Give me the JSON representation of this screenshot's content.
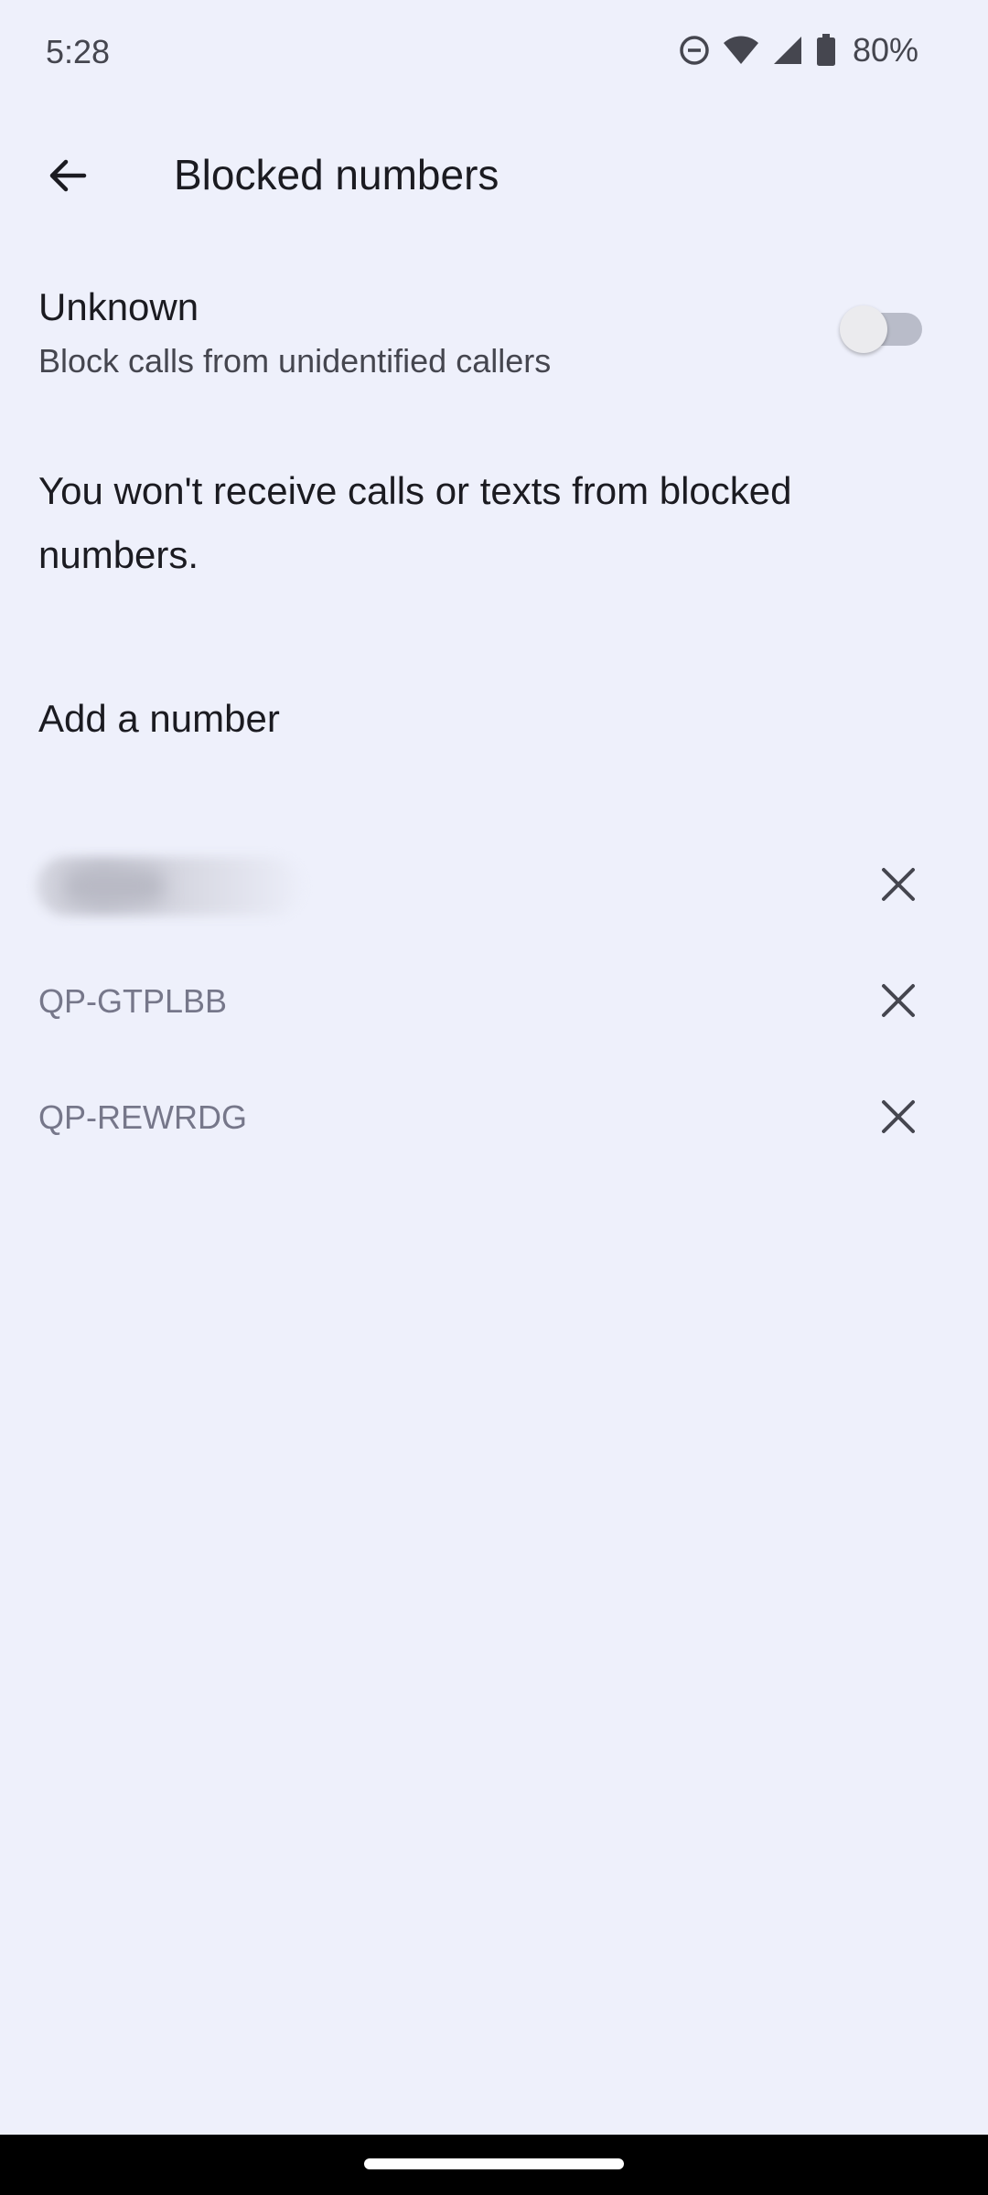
{
  "status_bar": {
    "time": "5:28",
    "battery_percent": "80%",
    "icons": [
      "do-not-disturb-icon",
      "wifi-icon",
      "cell-signal-icon",
      "battery-icon"
    ]
  },
  "app_bar": {
    "back_icon": "arrow-back-icon",
    "title": "Blocked numbers"
  },
  "unknown_setting": {
    "title": "Unknown",
    "subtitle": "Block calls from unidentified callers",
    "enabled": false
  },
  "info": {
    "text": "You won't receive calls or texts from blocked numbers."
  },
  "add_number": {
    "label": "Add a number"
  },
  "blocked_numbers": [
    {
      "number": "",
      "redacted": true
    },
    {
      "number": "QP-GTPLBB",
      "redacted": false
    },
    {
      "number": "QP-REWRDG",
      "redacted": false
    }
  ],
  "colors": {
    "background": "#eef0fb",
    "primary_text": "#1b1b21",
    "secondary_text": "#45464f",
    "muted_text": "#76778a",
    "switch_track_off": "#b9bcc9"
  }
}
